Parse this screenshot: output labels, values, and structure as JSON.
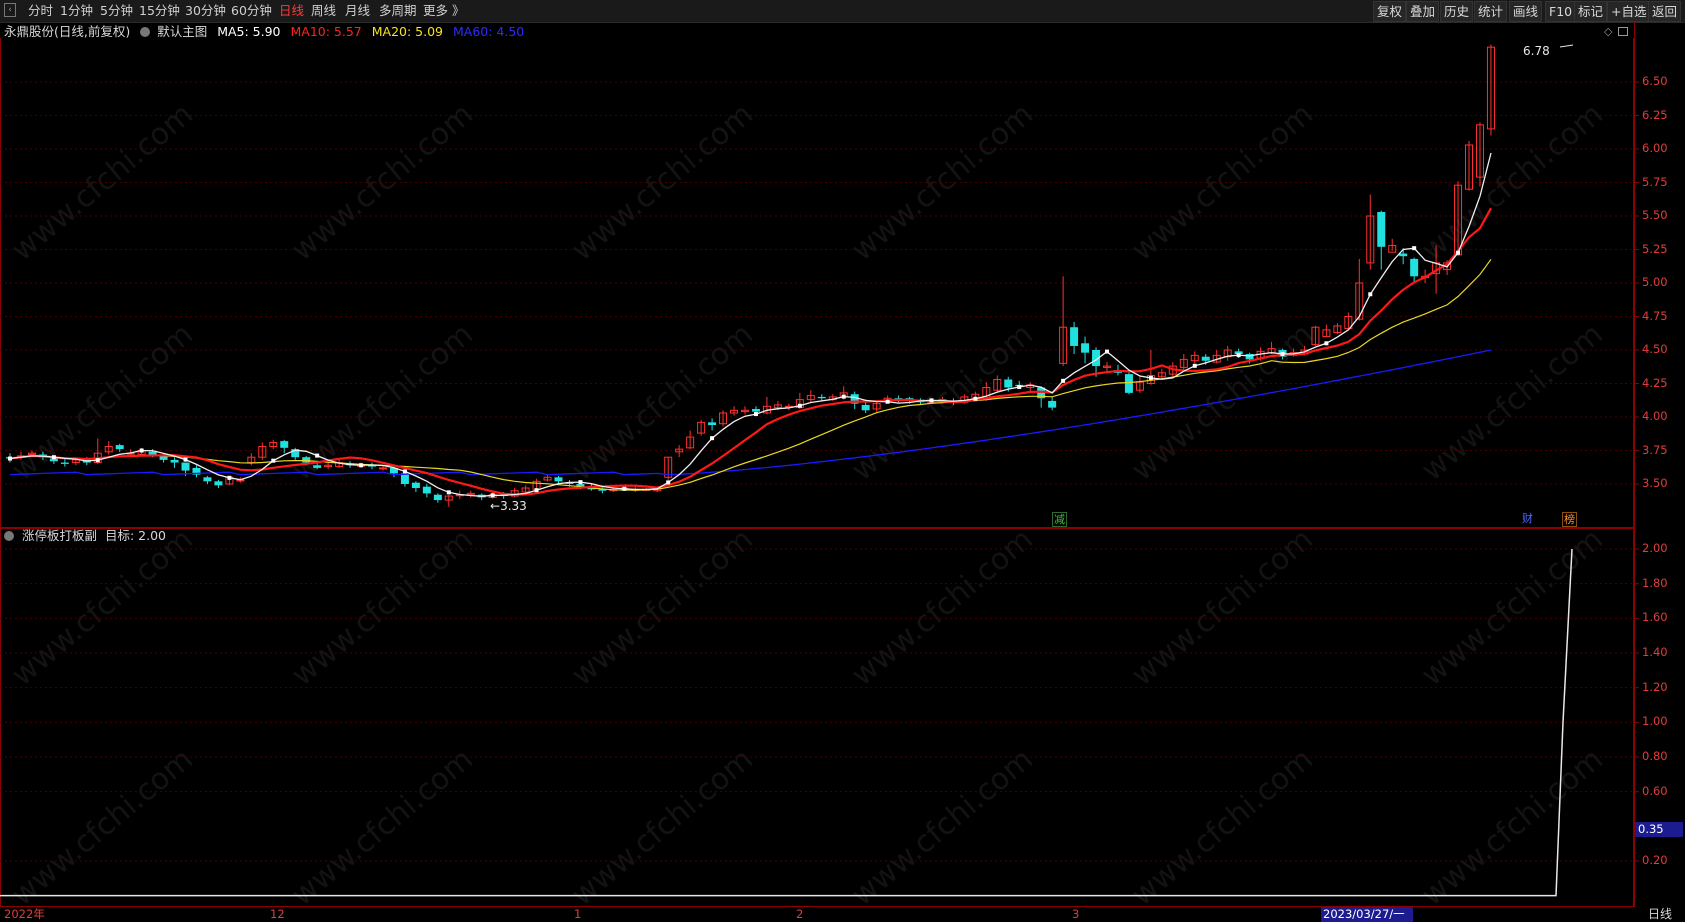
{
  "toolbar": {
    "periods": [
      "分时",
      "1分钟",
      "5分钟",
      "15分钟",
      "30分钟",
      "60分钟",
      "日线",
      "周线",
      "月线",
      "多周期",
      "更多 》"
    ],
    "active_period": "日线",
    "right_buttons": [
      "复权",
      "叠加",
      "历史",
      "统计",
      "画线",
      "F10",
      "标记",
      "+自选",
      "返回"
    ]
  },
  "main_chart": {
    "stock_label": "永鼎股份(日线,前复权)",
    "template_label": "默认主图",
    "ma_legend": [
      {
        "text": "MA5: 5.90",
        "color": "#ffffff"
      },
      {
        "text": "MA10: 5.57",
        "color": "#ff2020"
      },
      {
        "text": "MA20: 5.09",
        "color": "#f5e31b"
      },
      {
        "text": "MA60: 4.50",
        "color": "#2222ff"
      }
    ],
    "y_ticks": [
      "6.50",
      "6.25",
      "6.00",
      "5.75",
      "5.50",
      "5.25",
      "5.00",
      "4.75",
      "4.50",
      "4.25",
      "4.00",
      "3.75",
      "3.50"
    ],
    "y_tick_values": [
      6.5,
      6.25,
      6.0,
      5.75,
      5.5,
      5.25,
      5.0,
      4.75,
      4.5,
      4.25,
      4.0,
      3.75,
      3.5
    ],
    "high_label": "6.78",
    "low_label": "3.33",
    "event_markers": [
      {
        "text": "减",
        "color": "#40c040"
      },
      {
        "text": "财",
        "color": "#4060ff"
      },
      {
        "text": "榜",
        "color": "#ff9020"
      }
    ]
  },
  "indicator": {
    "label": "涨停板打板副",
    "target_text": "目标: 2.00",
    "y_ticks": [
      "2.00",
      "1.80",
      "1.60",
      "1.40",
      "1.20",
      "1.00",
      "0.80",
      "0.60",
      "0.20"
    ],
    "y_tick_values": [
      2.0,
      1.8,
      1.6,
      1.4,
      1.2,
      1.0,
      0.8,
      0.6,
      0.2
    ],
    "cursor_value": "0.35"
  },
  "x_axis": {
    "labels": [
      "2022年",
      "12",
      "1",
      "2",
      "3"
    ],
    "cursor_date": "2023/03/27/一",
    "bottom_right_label": "日线"
  },
  "watermark": "www.cfchi.com",
  "colors": {
    "up": "#ff3030",
    "down": "#20e0e0",
    "grid": "#5a0000",
    "axis": "#e23c3c"
  }
}
